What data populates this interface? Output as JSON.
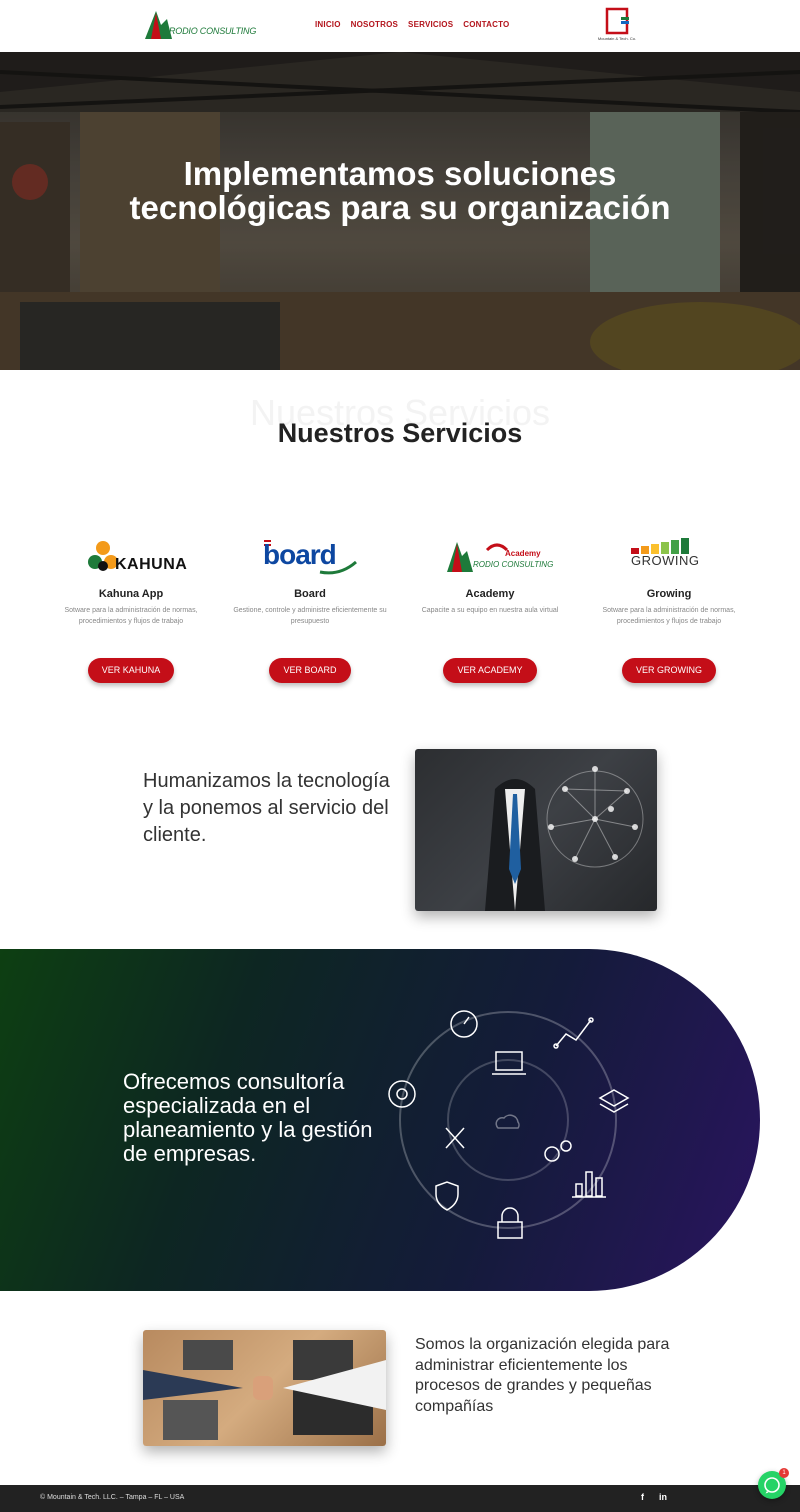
{
  "header": {
    "logo_text": "RODIO CONSULTING",
    "nav": [
      "INICIO",
      "NOSOTROS",
      "SERVICIOS",
      "CONTACTO"
    ],
    "partner_caption": "Mountain & Tech. Co."
  },
  "hero": {
    "title": "Implementamos soluciones tecnológicas para su organización"
  },
  "services": {
    "ghost_title": "Nuestros Servicios",
    "title": "Nuestros Servicios",
    "items": [
      {
        "logo_text": "KAHUNA",
        "name": "Kahuna App",
        "desc": "Sotware para la administración de normas, procedimientos y flujos de trabajo",
        "button": "VER KAHUNA"
      },
      {
        "logo_text": "board",
        "name": "Board",
        "desc": "Gestione, controle y administre eficientemente su presupuesto",
        "button": "VER BOARD"
      },
      {
        "logo_text": "RODIO CONSULTING",
        "logo_sub": "Academy",
        "name": "Academy",
        "desc": "Capacite a su equipo en nuestra aula virtual",
        "button": "VER ACADEMY"
      },
      {
        "logo_text": "GROWING",
        "name": "Growing",
        "desc": "Sotware para la administración de normas, procedimientos y flujos de trabajo",
        "button": "VER GROWING"
      }
    ]
  },
  "humanize": {
    "text": "Humanizamos la tecnología y la ponemos al servicio del cliente."
  },
  "consulting": {
    "text": "Ofrecemos consultoría especializada en el planeamiento y la gestión de empresas."
  },
  "org": {
    "text": "Somos la organización elegida para administrar eficientemente los procesos de grandes y pequeñas compañías"
  },
  "footer": {
    "copyright": "© Mountain & Tech. LLC. – Tampa – FL – USA",
    "social": [
      "f",
      "in"
    ]
  },
  "whatsapp": {
    "badge": "1"
  },
  "colors": {
    "accent": "#c40e18",
    "nav": "#b3141c",
    "footer": "#222222",
    "whatsapp": "#25d366"
  }
}
